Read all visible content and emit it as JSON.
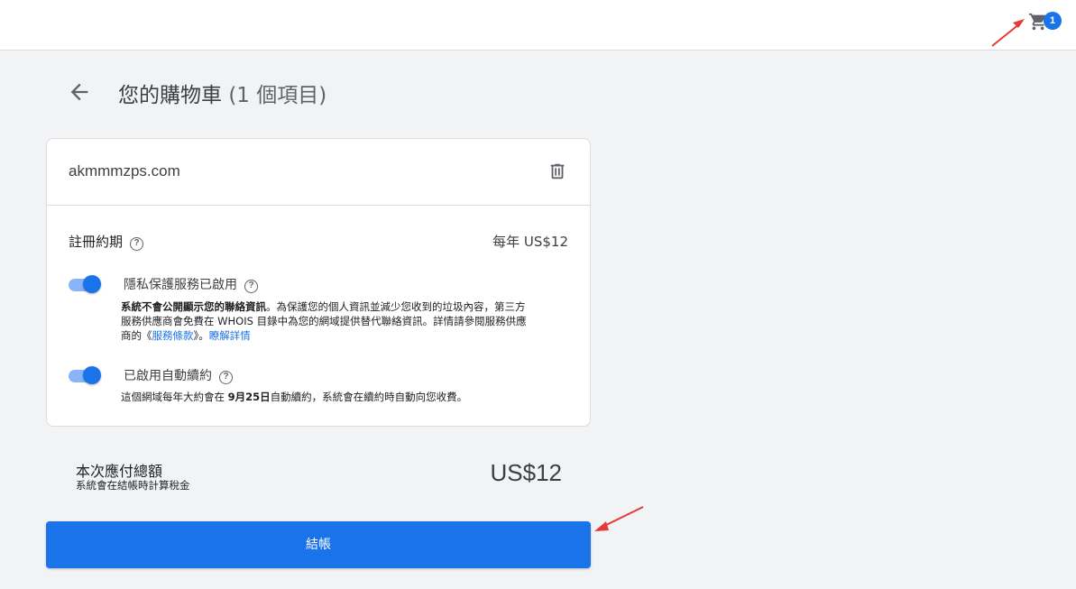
{
  "header": {
    "cart_count": "1"
  },
  "page": {
    "title": "您的購物車",
    "item_count": "(1 個項目)"
  },
  "cart_item": {
    "domain": "akmmmzps.com",
    "registration_term_label": "註冊約期",
    "price": "每年 US$12",
    "privacy": {
      "title": "隱私保護服務已啟用",
      "enabled": true,
      "desc_bold": "系統不會公開顯示您的聯絡資訊",
      "desc_text": "。為保護您的個人資訊並減少您收到的垃圾內容，第三方服務供應商會免費在 WHOIS 目錄中為您的網域提供替代聯絡資訊。詳情請參閱服務供應商的《",
      "terms_link": "服務條款",
      "desc_after_link": "》。",
      "learn_more_link": "瞭解詳情"
    },
    "auto_renew": {
      "title": "已啟用自動續約",
      "enabled": true,
      "desc_before": "這個網域每年大約會在 ",
      "renew_date": "9月25日",
      "desc_after": "自動續約，系統會在續約時自動向您收費。"
    }
  },
  "summary": {
    "total_label": "本次應付總額",
    "tax_note": "系統會在結帳時計算稅金",
    "total_amount": "US$12"
  },
  "checkout": {
    "label": "結帳"
  },
  "colors": {
    "accent": "#1a73e8",
    "annotation_arrow": "#e53935"
  }
}
